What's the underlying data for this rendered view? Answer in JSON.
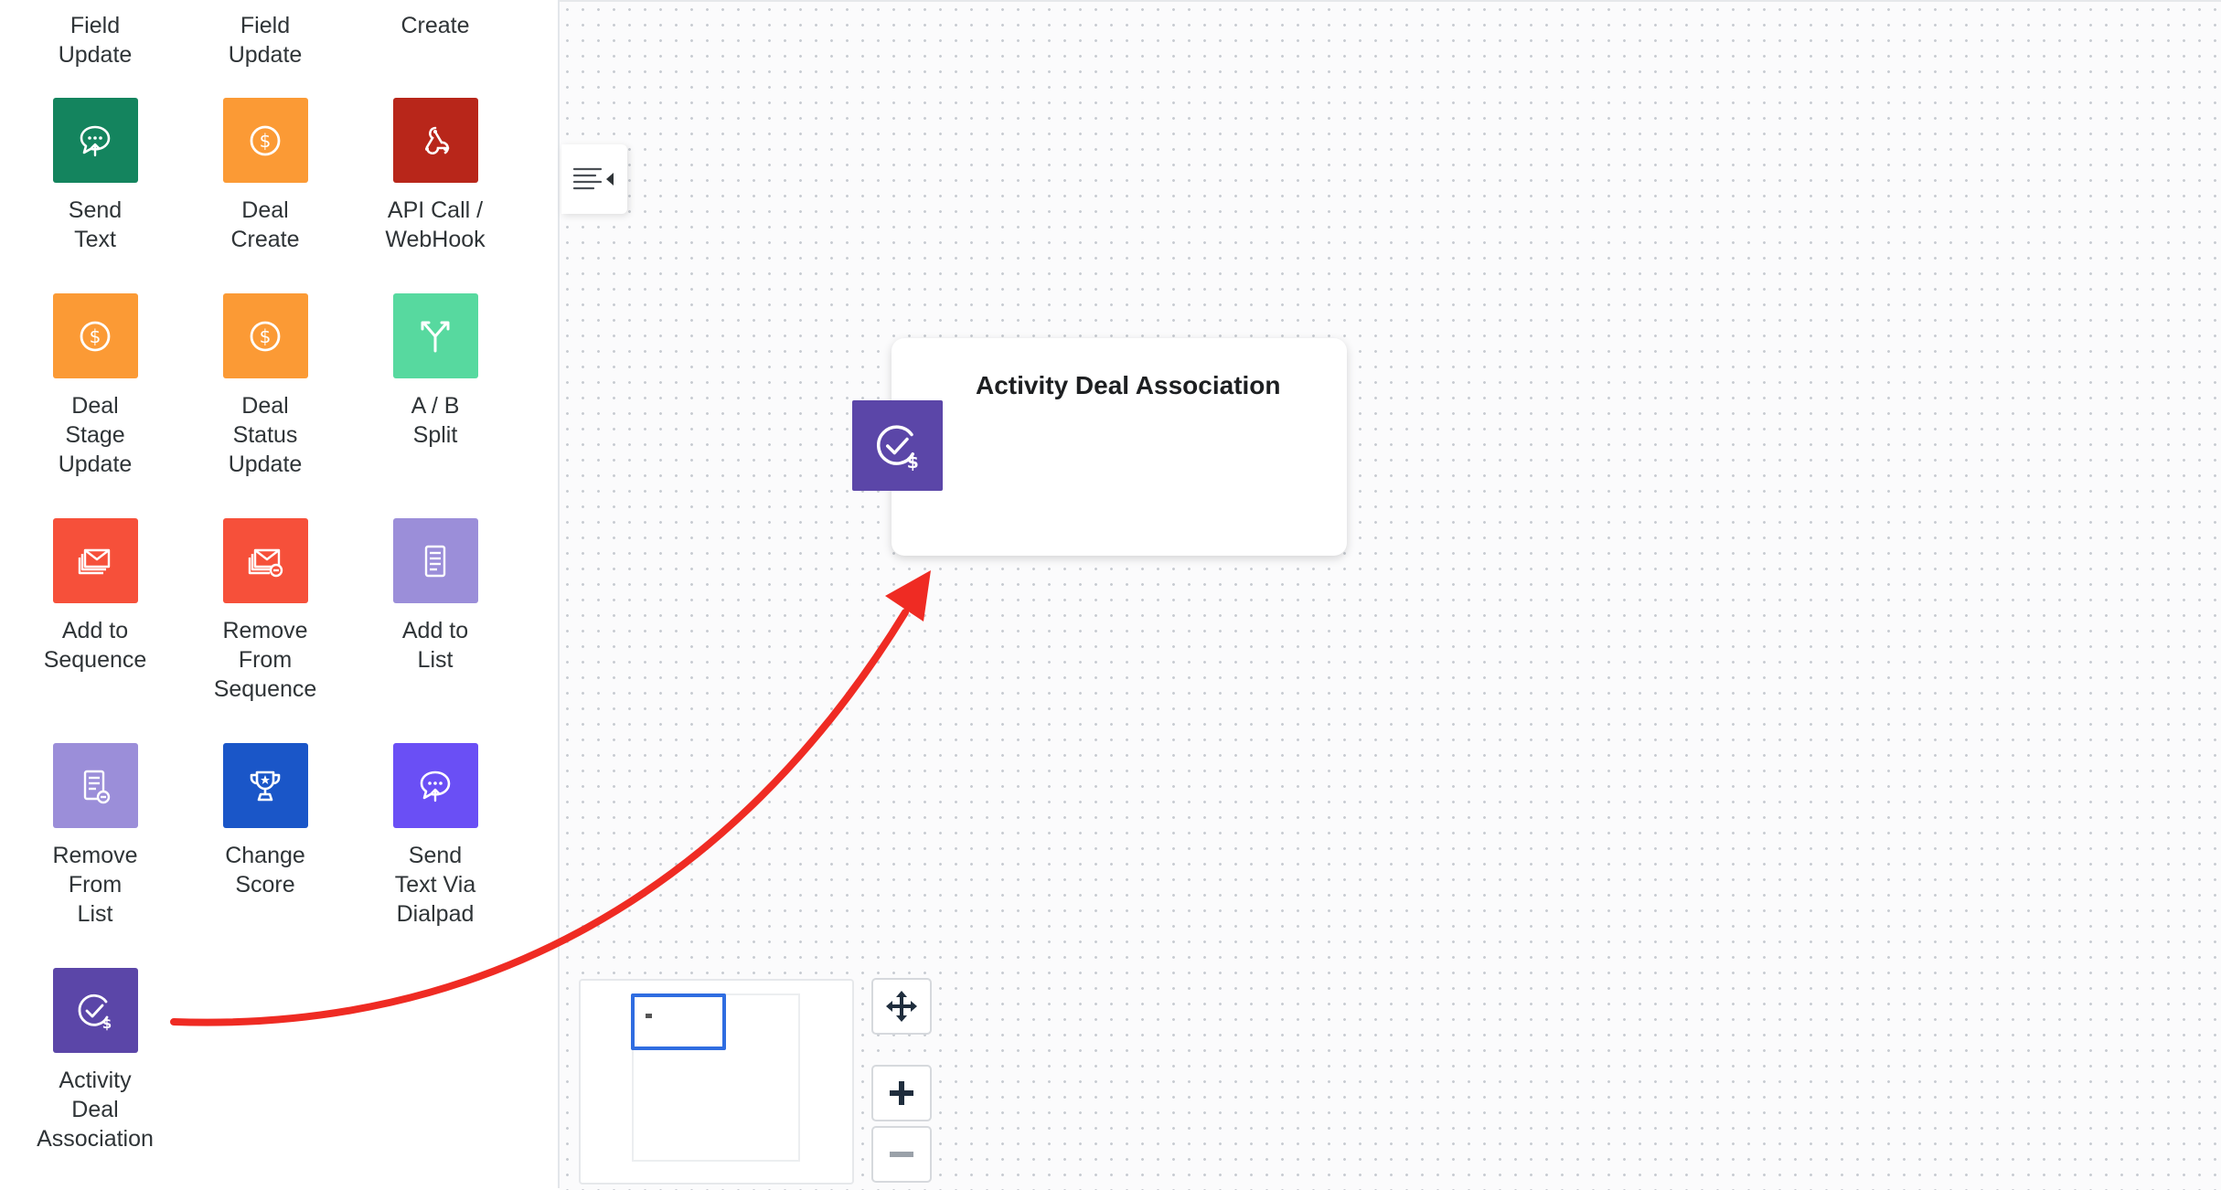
{
  "palette": {
    "items": [
      {
        "label": "Field\nUpdate",
        "color": "#ffffff",
        "icon": "none"
      },
      {
        "label": "Field\nUpdate",
        "color": "#ffffff",
        "icon": "none"
      },
      {
        "label": "Create",
        "color": "#ffffff",
        "icon": "none"
      },
      {
        "label": "Send\nText",
        "color": "#14845e",
        "icon": "chat-icon"
      },
      {
        "label": "Deal\nCreate",
        "color": "#fb9a35",
        "icon": "dollar-icon"
      },
      {
        "label": "API Call /\nWebHook",
        "color": "#b8261a",
        "icon": "webhook-icon"
      },
      {
        "label": "Deal\nStage\nUpdate",
        "color": "#fb9a35",
        "icon": "dollar-icon"
      },
      {
        "label": "Deal\nStatus\nUpdate",
        "color": "#fb9a35",
        "icon": "dollar-icon"
      },
      {
        "label": "A / B\nSplit",
        "color": "#57d99f",
        "icon": "split-icon"
      },
      {
        "label": "Add to\nSequence",
        "color": "#f6503a",
        "icon": "mail-stack-icon"
      },
      {
        "label": "Remove\nFrom\nSequence",
        "color": "#f6503a",
        "icon": "mail-remove-icon"
      },
      {
        "label": "Add to\nList",
        "color": "#9b8ed9",
        "icon": "list-icon"
      },
      {
        "label": "Remove\nFrom\nList",
        "color": "#9b8ed9",
        "icon": "list-remove-icon"
      },
      {
        "label": "Change\nScore",
        "color": "#1a56c8",
        "icon": "trophy-icon"
      },
      {
        "label": "Send\nText Via\nDialpad",
        "color": "#6a4ff5",
        "icon": "chat-icon"
      },
      {
        "label": "Activity\nDeal\nAssociation",
        "color": "#5b46a8",
        "icon": "activity-deal-icon"
      }
    ]
  },
  "canvas": {
    "node": {
      "title": "Activity Deal Association",
      "icon": "activity-deal-icon",
      "color": "#5b46a8"
    },
    "arrow_color": "#ef2b23",
    "controls": [
      "move-icon",
      "zoom-in-icon",
      "zoom-out-icon"
    ]
  }
}
